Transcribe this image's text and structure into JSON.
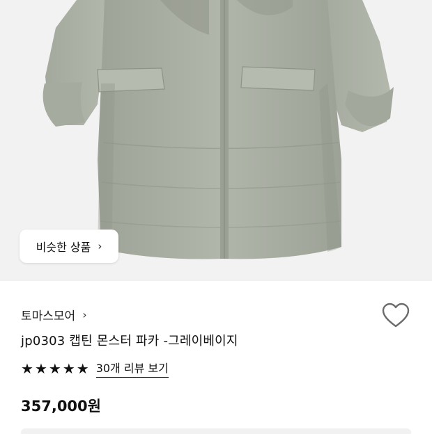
{
  "product": {
    "image_icon": "puffer-parka-photo",
    "similar_button_label": "비슷한 상품",
    "store_name": "토마스모어",
    "title": "jp0303 캡틴 몬스터 파카 -그레이베이지",
    "rating_stars": 5,
    "reviews_link": "30개 리뷰 보기",
    "price": "357,000원"
  },
  "icons": {
    "heart": "heart-outline-icon",
    "chevron": "chevron-right-icon",
    "star": "star-filled-icon"
  },
  "colors": {
    "parka": "#a9aea3",
    "background": "#f2f2f2",
    "text": "#111111"
  }
}
